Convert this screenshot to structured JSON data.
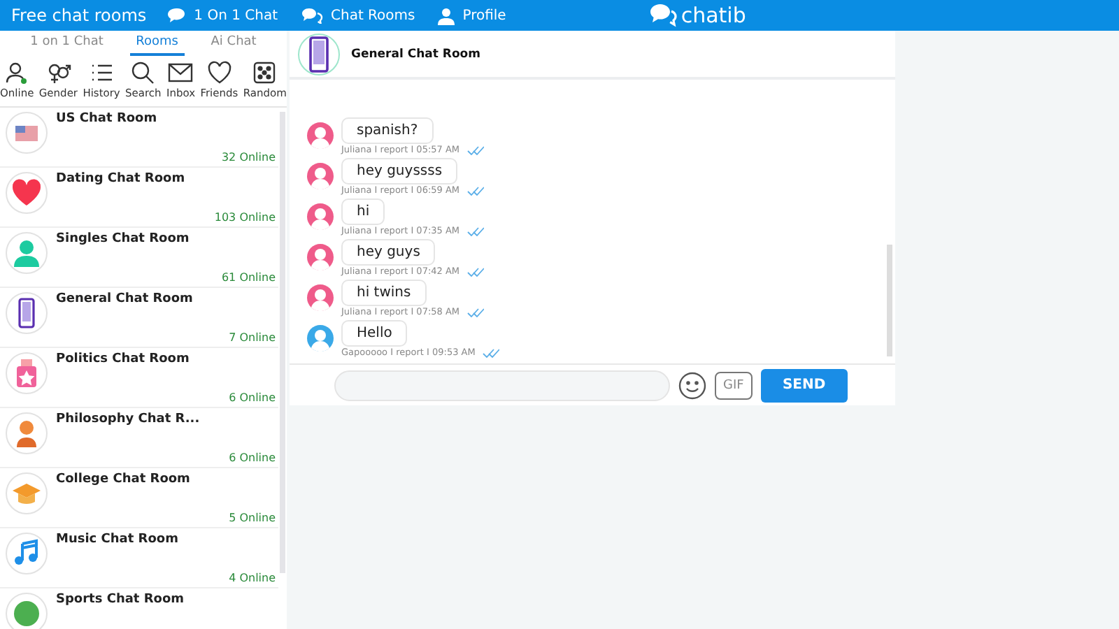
{
  "top_nav": {
    "site_title": "Free chat rooms",
    "links": [
      {
        "kind": "chat",
        "label": "1 On 1 Chat"
      },
      {
        "kind": "chats",
        "label": "Chat Rooms"
      },
      {
        "kind": "person",
        "label": "Profile"
      }
    ],
    "logo": "chatib"
  },
  "tabs": [
    {
      "label": "1 on 1 Chat",
      "selected": false
    },
    {
      "label": "Rooms",
      "selected": true
    },
    {
      "label": "Ai Chat",
      "selected": false
    }
  ],
  "tools": [
    {
      "kind": "online",
      "label": "Online"
    },
    {
      "kind": "gender",
      "label": "Gender"
    },
    {
      "kind": "history",
      "label": "History"
    },
    {
      "kind": "search",
      "label": "Search"
    },
    {
      "kind": "inbox",
      "label": "Inbox"
    },
    {
      "kind": "friends",
      "label": "Friends"
    },
    {
      "kind": "random",
      "label": "Random"
    }
  ],
  "rooms": [
    {
      "kind": "flag",
      "name": "US Chat Room",
      "online": "32 Online"
    },
    {
      "kind": "heart",
      "name": "Dating Chat Room",
      "online": "103 Online"
    },
    {
      "kind": "person",
      "name": "Singles Chat Room",
      "online": "61 Online"
    },
    {
      "kind": "phone",
      "name": "General Chat Room",
      "online": "7 Online"
    },
    {
      "kind": "star",
      "name": "Politics Chat Room",
      "online": "6 Online"
    },
    {
      "kind": "thinker",
      "name": "Philosophy Chat R...",
      "online": "6 Online"
    },
    {
      "kind": "cap",
      "name": "College Chat Room",
      "online": "5 Online"
    },
    {
      "kind": "note",
      "name": "Music Chat Room",
      "online": "4 Online"
    },
    {
      "kind": "ball",
      "name": "Sports Chat Room"
    }
  ],
  "chat": {
    "room_title": "General Chat Room",
    "messages": [
      {
        "text": "spanish?",
        "meta": "Juliana I report I 05:57 AM",
        "color": "#ef5b8a"
      },
      {
        "text": "hey guyssss",
        "meta": "Juliana I report I 06:59 AM",
        "color": "#ef5b8a"
      },
      {
        "text": "hi",
        "meta": "Juliana I report I 07:35 AM",
        "color": "#ef5b8a"
      },
      {
        "text": "hey guys",
        "meta": "Juliana I report I 07:42 AM",
        "color": "#ef5b8a"
      },
      {
        "text": "hi twins",
        "meta": "Juliana I report I 07:58 AM",
        "color": "#ef5b8a"
      },
      {
        "text": "Hello",
        "meta": "Gapooooo I report I 09:53 AM",
        "color": "#3aa9e8"
      }
    ],
    "gif_label": "GIF",
    "send_label": "SEND"
  }
}
